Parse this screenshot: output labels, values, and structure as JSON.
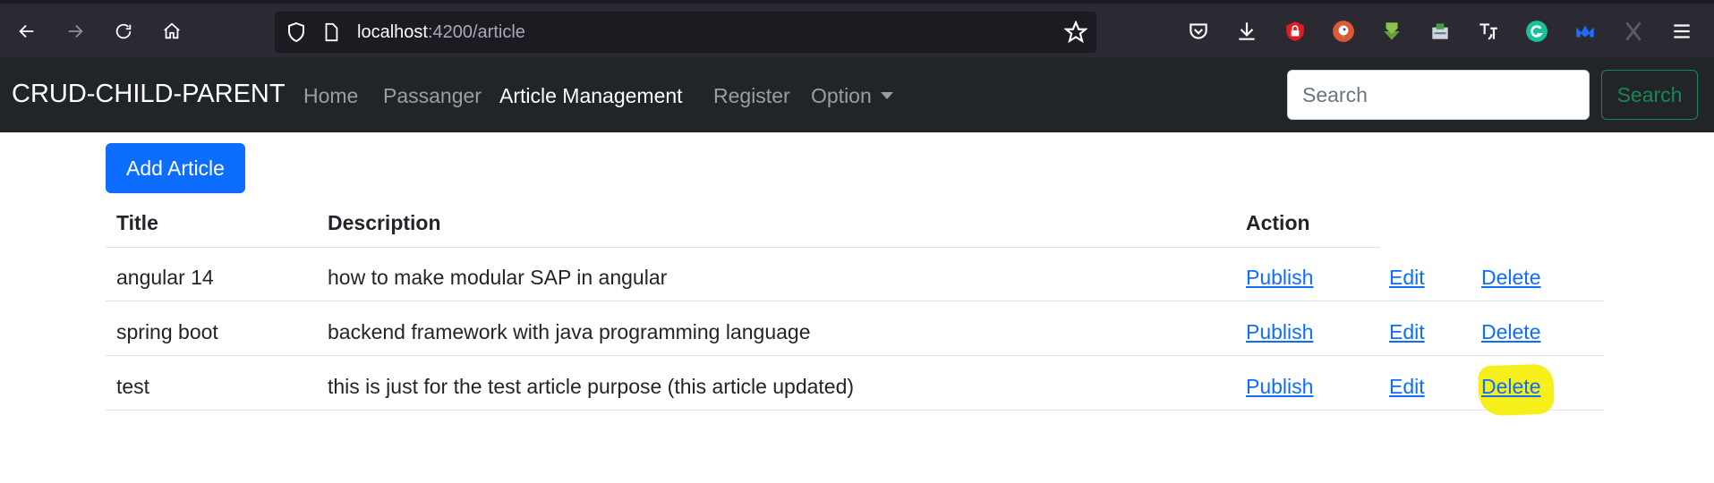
{
  "browser": {
    "url_host": "localhost",
    "url_path": ":4200/article",
    "extensions": [
      "pocket-icon",
      "download-icon",
      "adblock-icon",
      "duckduckgo-icon",
      "arrow-down-icon",
      "extension-icon",
      "translate-icon",
      "grammarly-icon",
      "malwarebytes-icon",
      "x-icon",
      "menu-icon"
    ]
  },
  "navbar": {
    "brand": "CRUD-CHILD-PARENT",
    "links": [
      {
        "label": "Home"
      },
      {
        "label": "Passanger"
      },
      {
        "label": "Article Management"
      },
      {
        "label": "Register"
      },
      {
        "label": "Option"
      }
    ],
    "search_placeholder": "Search",
    "search_button": "Search"
  },
  "content": {
    "add_button": "Add Article",
    "table": {
      "headers": {
        "title": "Title",
        "description": "Description",
        "action": "Action"
      },
      "rows": [
        {
          "title": "angular 14",
          "description": "how to make modular SAP in angular",
          "publish": "Publish",
          "edit": "Edit",
          "delete": "Delete"
        },
        {
          "title": "spring boot",
          "description": "backend framework with java programming language",
          "publish": "Publish",
          "edit": "Edit",
          "delete": "Delete"
        },
        {
          "title": "test",
          "description": "this is just for the test article purpose (this article updated)",
          "publish": "Publish",
          "edit": "Edit",
          "delete": "Delete"
        }
      ]
    }
  },
  "colors": {
    "navbar_bg": "#212529",
    "primary": "#0d6efd",
    "success": "#198754",
    "highlight": "#f6ef1a"
  }
}
